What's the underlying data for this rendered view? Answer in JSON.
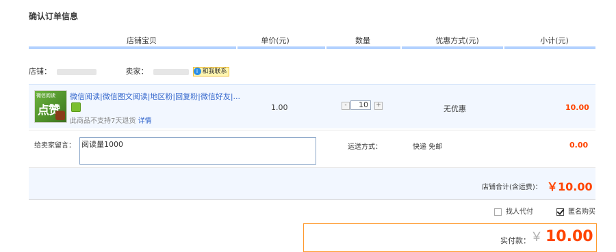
{
  "page_title": "确认订单信息",
  "columns": {
    "item": "店铺宝贝",
    "unit_price": "单价(元)",
    "quantity": "数量",
    "discount": "优惠方式(元)",
    "subtotal": "小计(元)"
  },
  "shop": {
    "shop_label": "店铺：",
    "seller_label": "卖家：",
    "contact_label": "和我联系"
  },
  "item": {
    "title": "微信阅读|微信图文阅读|地区粉|回复粉|微信好友|...",
    "thumb_text_top": "微信阅读",
    "thumb_text_main": "点赞",
    "no_return": "此商品不支持7天退货",
    "details_link": "详情",
    "price": "1.00",
    "quantity": "10",
    "discount": "无优惠",
    "subtotal": "10.00",
    "decrease": "-",
    "increase": "+"
  },
  "message": {
    "label": "给卖家留言：",
    "value": "阅读量1000"
  },
  "shipping": {
    "label": "运送方式：",
    "method": "快递 免邮",
    "fee": "0.00"
  },
  "shop_total": {
    "label": "店铺合计(含运费)：",
    "amount": "￥10.00"
  },
  "options": {
    "proxy_pay": "找人代付",
    "proxy_pay_checked": false,
    "anonymous": "匿名购买",
    "anonymous_checked": true
  },
  "payment": {
    "label": "实付款：",
    "currency": "￥",
    "amount": "10.00"
  },
  "colors": {
    "accent_price": "#ff4400",
    "header_bar": "#b2d1ff",
    "row_bg": "#f2f7ff",
    "link": "#3366cc",
    "pay_border": "#ff9a2e"
  }
}
